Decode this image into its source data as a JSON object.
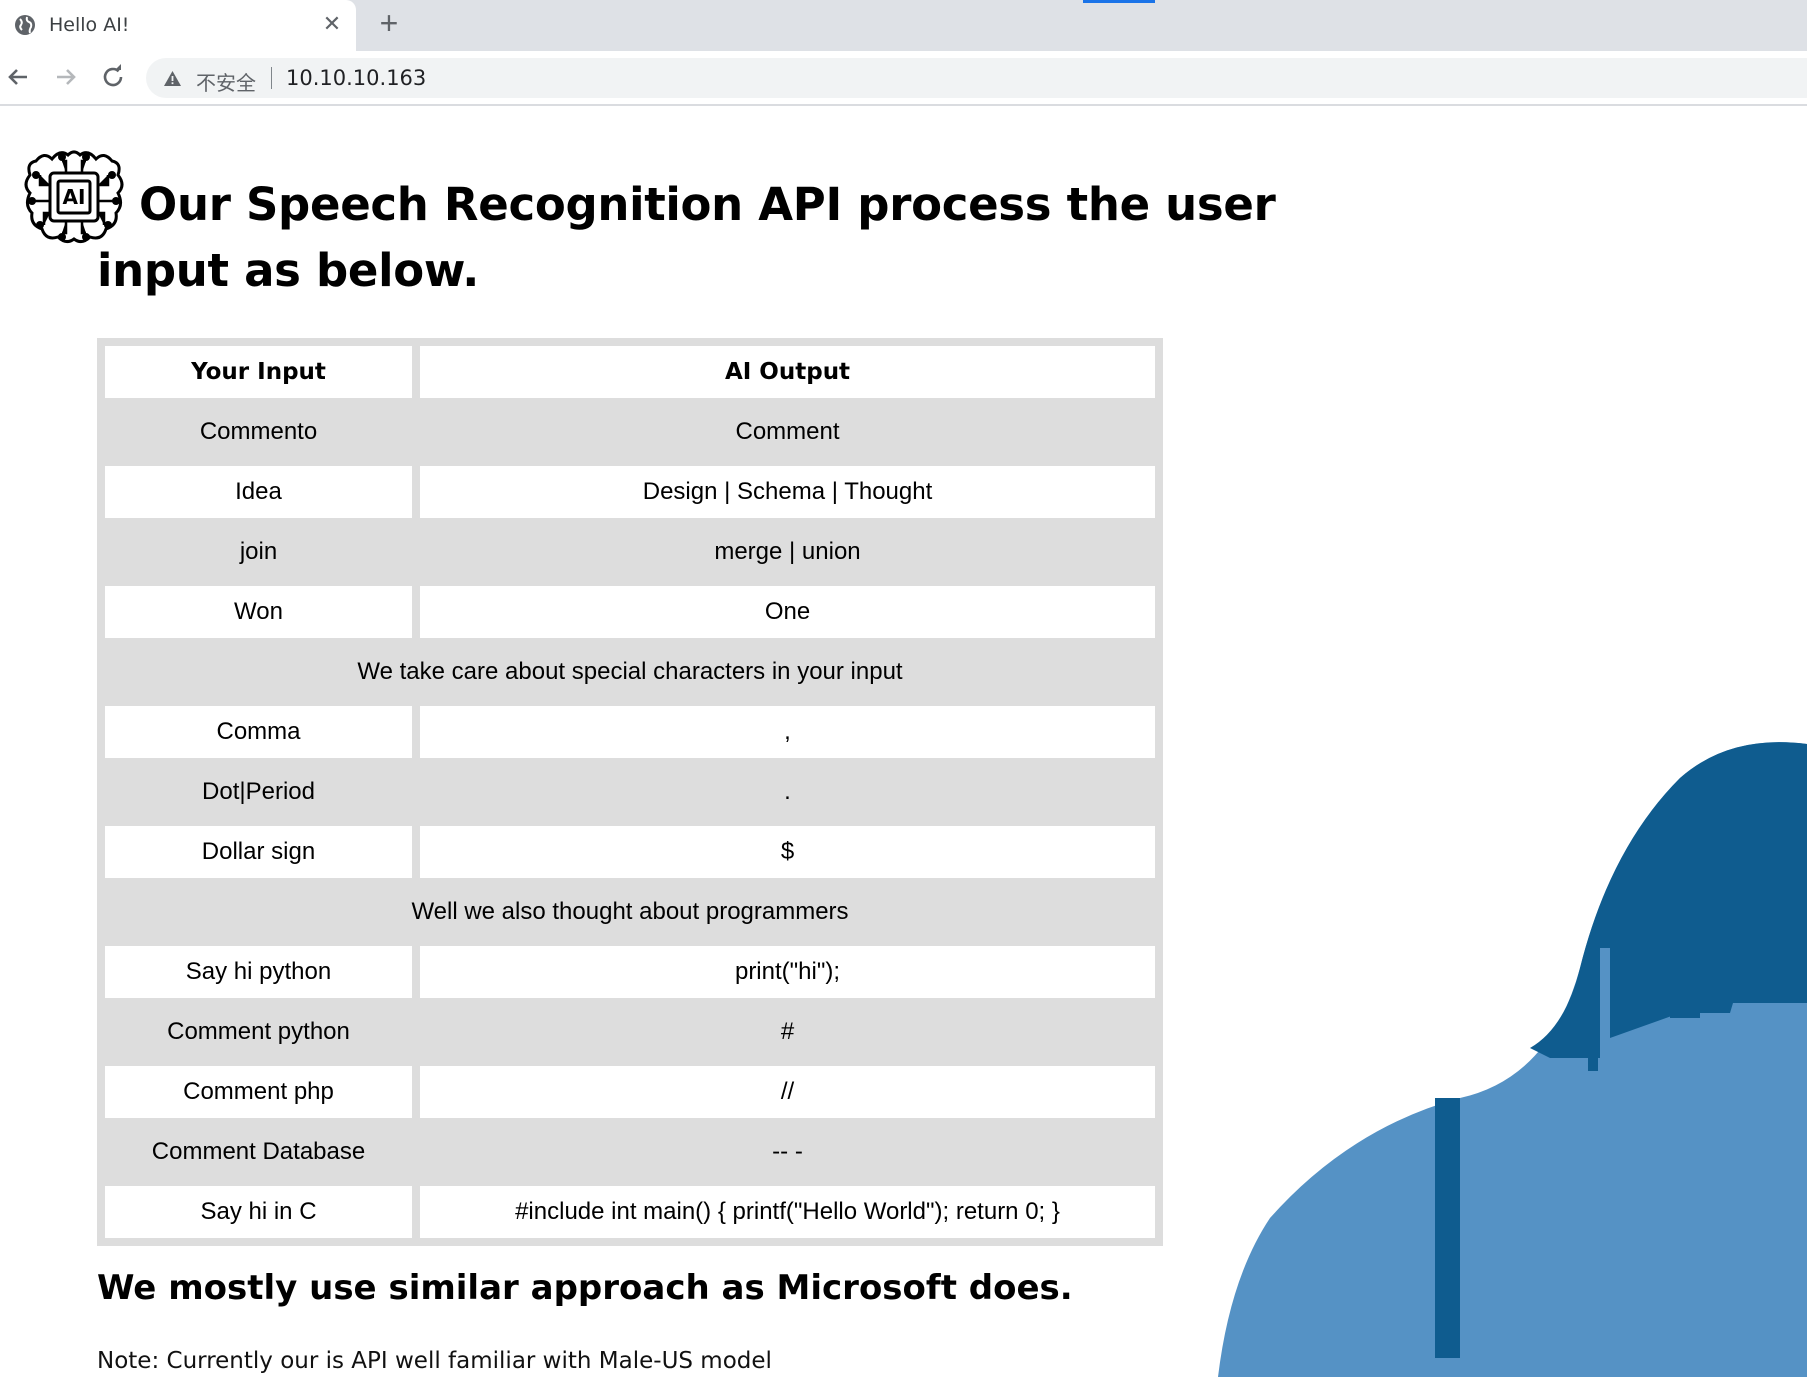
{
  "browser": {
    "tab_title": "Hello AI!",
    "tab_close": "✕",
    "new_tab": "+",
    "insecure_label": "不安全",
    "url": "10.10.10.163"
  },
  "page": {
    "logo_text": "AI",
    "heading": "Our Speech Recognition API process the user input as below.",
    "table": {
      "headers": [
        "Your Input",
        "AI Output"
      ],
      "rows": [
        {
          "input": "Commento",
          "output": "Comment"
        },
        {
          "input": "Idea",
          "output": "Design | Schema | Thought"
        },
        {
          "input": "join",
          "output": "merge | union"
        },
        {
          "input": "Won",
          "output": "One"
        },
        {
          "section": "We take care about special characters in your input"
        },
        {
          "input": "Comma",
          "output": ","
        },
        {
          "input": "Dot|Period",
          "output": "."
        },
        {
          "input": "Dollar sign",
          "output": "$"
        },
        {
          "section": "Well we also thought about programmers"
        },
        {
          "input": "Say hi python",
          "output": "print(\"hi\");"
        },
        {
          "input": "Comment python",
          "output": "#"
        },
        {
          "input": "Comment php",
          "output": "//"
        },
        {
          "input": "Comment Database",
          "output": "-- -"
        },
        {
          "input": "Say hi in C",
          "output": "#include int main() { printf(\"Hello World\"); return 0; }"
        }
      ]
    },
    "subheading": "We mostly use similar approach as Microsoft does.",
    "note": "Note: Currently our is API well familiar with Male-US model"
  },
  "colors": {
    "tabstrip": "#dee1e6",
    "table_gray": "#dddddd",
    "decor_dark": "#0f5c8f",
    "decor_light": "#5592c5"
  }
}
